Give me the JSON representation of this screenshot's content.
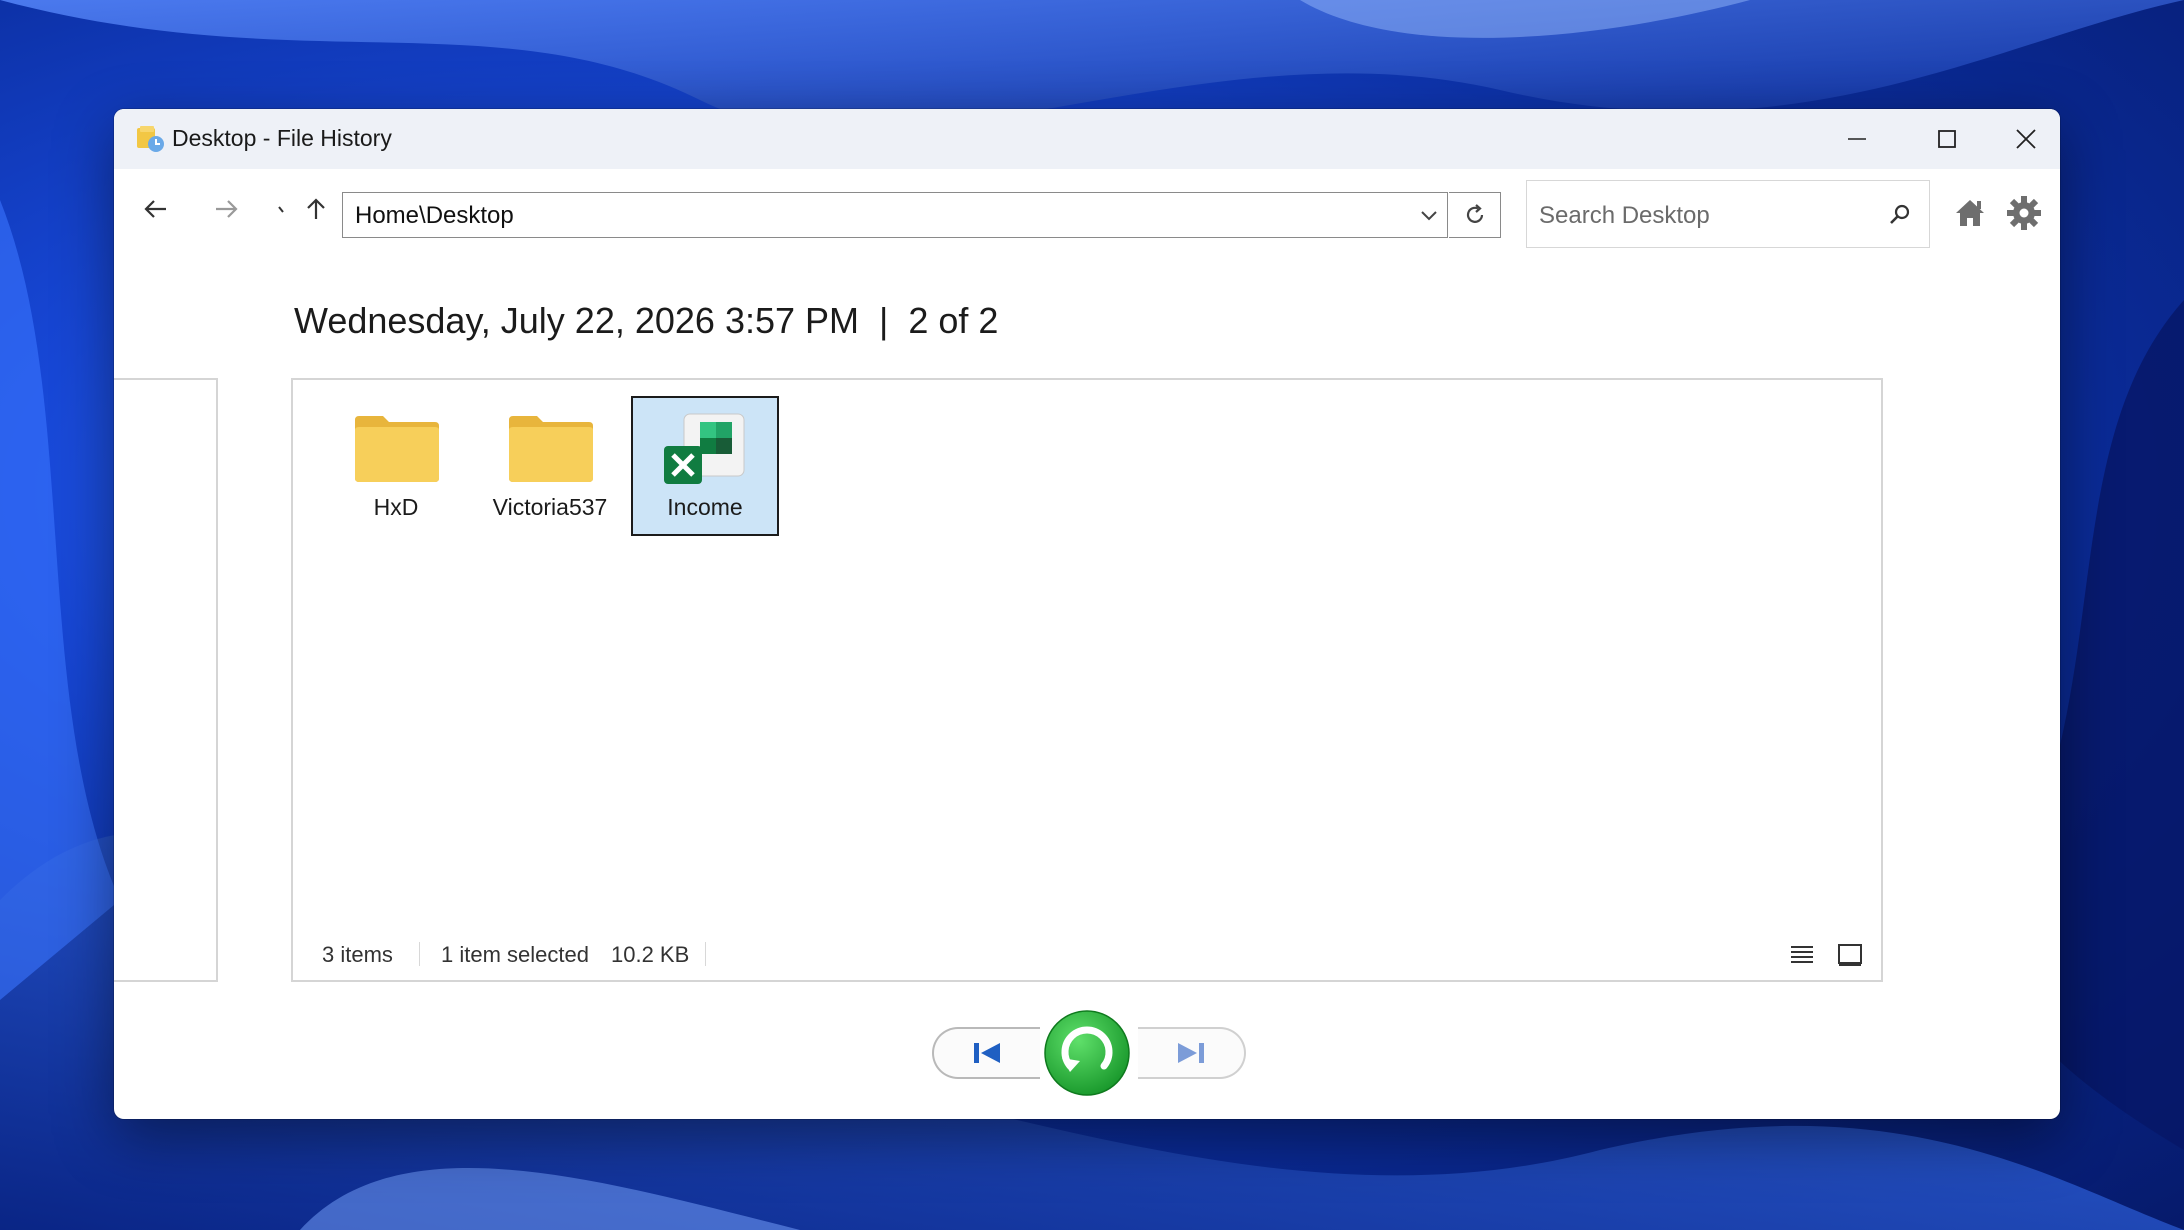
{
  "window": {
    "title": "Desktop - File History"
  },
  "toolbar": {
    "address": "Home\\Desktop",
    "search_placeholder": "Search Desktop"
  },
  "snapshot": {
    "date": "Wednesday, July 22, 2026 3:57 PM",
    "separator": "|",
    "position": "2 of 2"
  },
  "files": [
    {
      "label": "HxD",
      "type": "folder",
      "icon": "folder-icon",
      "selected": false
    },
    {
      "label": "Victoria537",
      "type": "folder",
      "icon": "folder-icon",
      "selected": false
    },
    {
      "label": "Income",
      "type": "excel",
      "icon": "excel-file-icon",
      "selected": true
    }
  ],
  "status": {
    "item_count": "3 items",
    "selection": "1 item selected",
    "size": "10.2 KB"
  },
  "colors": {
    "selection_bg": "#cce4f7",
    "restore_green": "#2fb63a",
    "nav_blue": "#1f5fc2",
    "folder_yellow": "#f7cf5a"
  }
}
